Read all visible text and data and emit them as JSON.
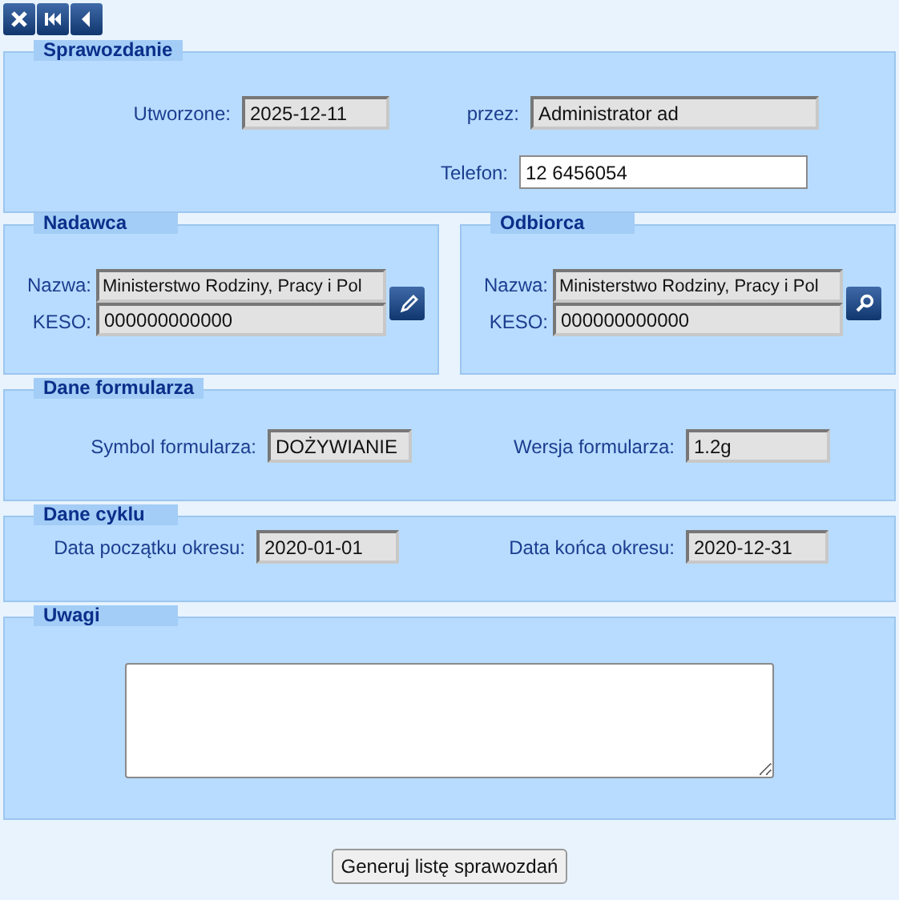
{
  "toolbar": [
    {
      "kind": "close"
    },
    {
      "kind": "first"
    },
    {
      "kind": "prev"
    }
  ],
  "report": {
    "title": "Sprawozdanie",
    "created": {
      "label": "Utworzone:",
      "value": "2025-12-11",
      "disabled": true
    },
    "by": {
      "label": "przez:",
      "value": "Administrator ad",
      "disabled": true
    },
    "phone": {
      "label": "Telefon:",
      "value": "12 6456054",
      "disabled": false
    }
  },
  "parties": [
    {
      "title": "Nadawca",
      "kind": "edit",
      "name": {
        "label": "Nazwa:",
        "value": "Ministerstwo Rodziny, Pracy i Pol",
        "disabled": true
      },
      "keso": {
        "label": "KESO:",
        "value": "000000000000",
        "disabled": true
      }
    },
    {
      "title": "Odbiorca",
      "kind": "search",
      "name": {
        "label": "Nazwa:",
        "value": "Ministerstwo Rodziny, Pracy i Pol",
        "disabled": true
      },
      "keso": {
        "label": "KESO:",
        "value": "000000000000",
        "disabled": true
      }
    }
  ],
  "form_data": {
    "title": "Dane formularza",
    "symbol": {
      "label": "Symbol formularza:",
      "value": "DOŻYWIANIE",
      "disabled": true
    },
    "version": {
      "label": "Wersja formularza:",
      "value": "1.2g",
      "disabled": true
    }
  },
  "cycle": {
    "title": "Dane cyklu",
    "start": {
      "label": "Data początku okresu:",
      "value": "2020-01-01",
      "disabled": true
    },
    "end": {
      "label": "Data końca okresu:",
      "value": "2020-12-31",
      "disabled": true
    }
  },
  "notes": {
    "title": "Uwagi"
  },
  "generate_button": {
    "label": "Generuj listę sprawozdań"
  }
}
